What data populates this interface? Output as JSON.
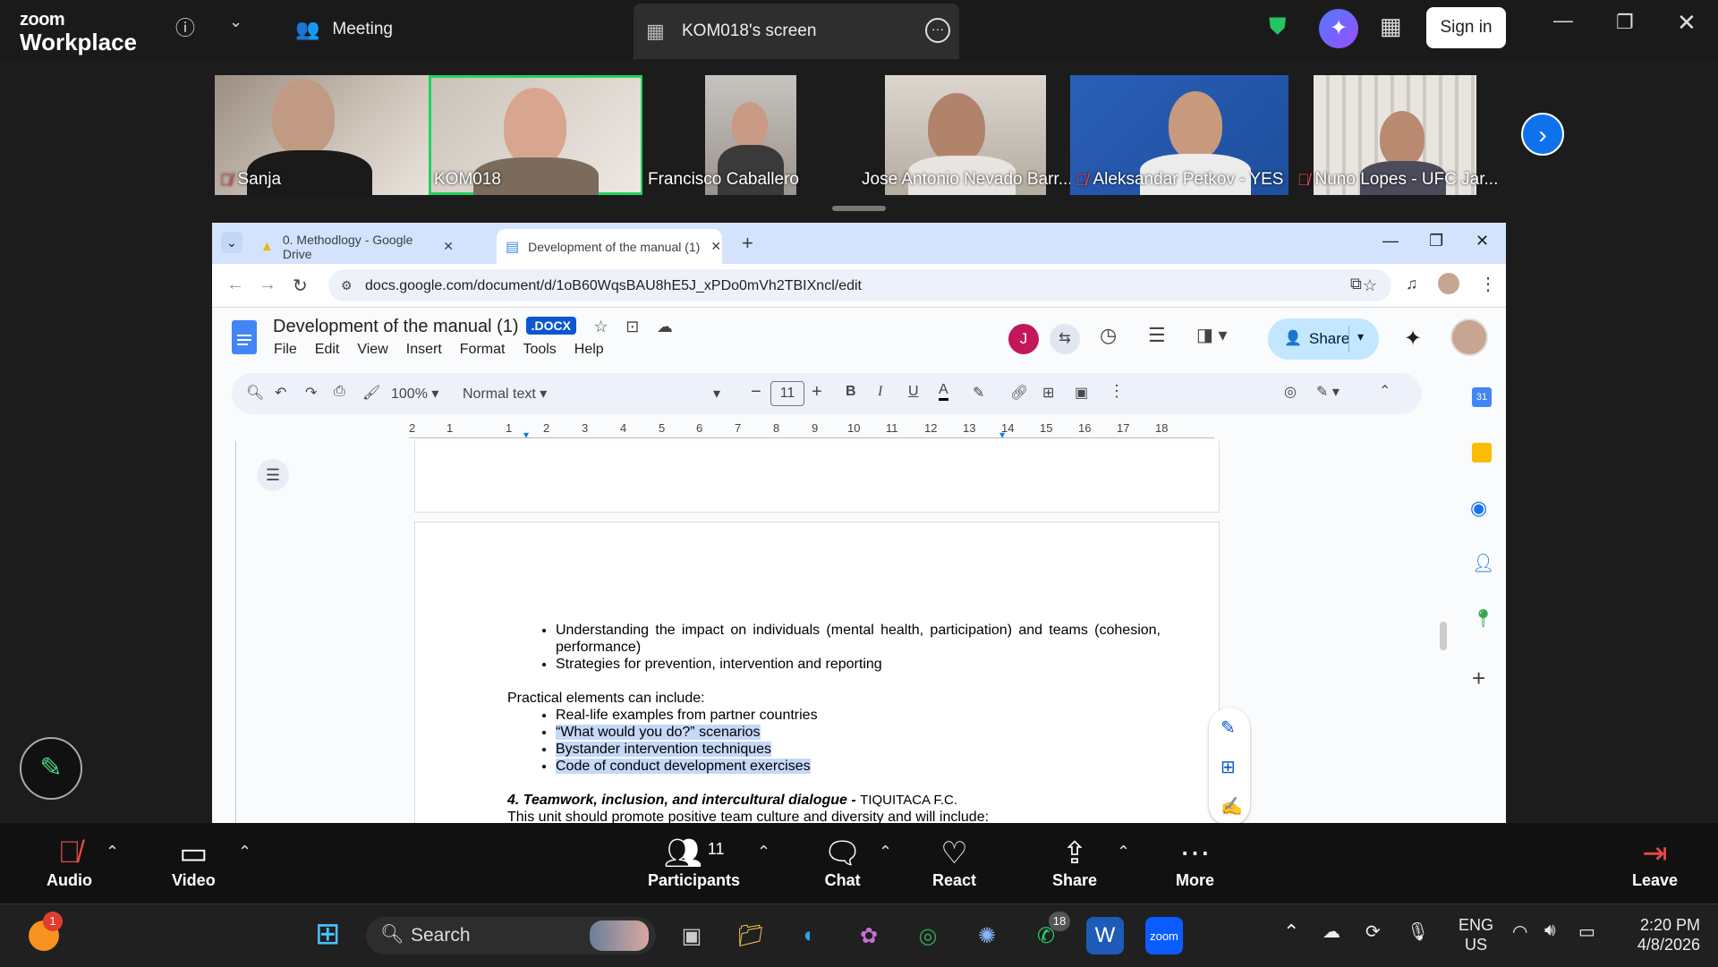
{
  "zoom": {
    "logo_top": "zoom",
    "logo_bottom": "Workplace",
    "meeting_label": "Meeting",
    "screen_tab_label": "KOM018's screen",
    "signin_label": "Sign in"
  },
  "participants_gallery": [
    {
      "name": "Sanja",
      "muted": true
    },
    {
      "name": "KOM018",
      "muted": false,
      "active_speaker": true
    },
    {
      "name": "Francisco Caballero",
      "muted": false
    },
    {
      "name": "Jose Antonio Nevado Barr...",
      "muted": false
    },
    {
      "name": "Aleksandar Petkov - YES",
      "muted": true
    },
    {
      "name": "Nuno Lopes - UFC Jar...",
      "muted": true
    }
  ],
  "browser": {
    "tabs": [
      {
        "label": "0. Methodlogy - Google Drive",
        "active": false
      },
      {
        "label": "Development of the manual (1)",
        "active": true
      }
    ],
    "url": "docs.google.com/document/d/1oB60WqsBAU8hE5J_xPDo0mVh2TBIXncl/edit"
  },
  "docs": {
    "title": "Development of the manual (1)",
    "badge": ".DOCX",
    "menus": [
      "File",
      "Edit",
      "View",
      "Insert",
      "Format",
      "Tools",
      "Help"
    ],
    "avatar_letter": "J",
    "share_label": "Share",
    "toolbar": {
      "zoom": "100%",
      "style": "Normal text",
      "font_size": "11"
    },
    "ruler_ticks": [
      "2",
      "1",
      "1",
      "2",
      "3",
      "4",
      "5",
      "6",
      "7",
      "8",
      "9",
      "10",
      "11",
      "12",
      "13",
      "14",
      "15",
      "16",
      "17",
      "18"
    ],
    "body": {
      "bullets_top": [
        "Understanding the impact on individuals (mental health, participation) and teams (cohesion, performance)",
        "Strategies for prevention, intervention and reporting"
      ],
      "practical_intro": "Practical elements can include:",
      "practical_items": [
        "Real-life examples from partner countries",
        "“What would you do?” scenarios",
        "Bystander intervention techniques",
        "Code of conduct development exercises"
      ],
      "heading4": "4. Teamwork, inclusion, and intercultural dialogue -",
      "heading4_org": "TIQUITACA F.C.",
      "next_line": "This unit should promote positive team culture and diversity and will include:"
    }
  },
  "zoom_controls": {
    "audio": "Audio",
    "video": "Video",
    "participants": "Participants",
    "participants_count": "11",
    "chat": "Chat",
    "react": "React",
    "share": "Share",
    "more": "More",
    "leave": "Leave"
  },
  "taskbar": {
    "search_label": "Search",
    "whatsapp_badge": "18",
    "notif_badge": "1",
    "lang_top": "ENG",
    "lang_bottom": "US",
    "time": "2:20 PM",
    "date": "4/8/2026"
  }
}
